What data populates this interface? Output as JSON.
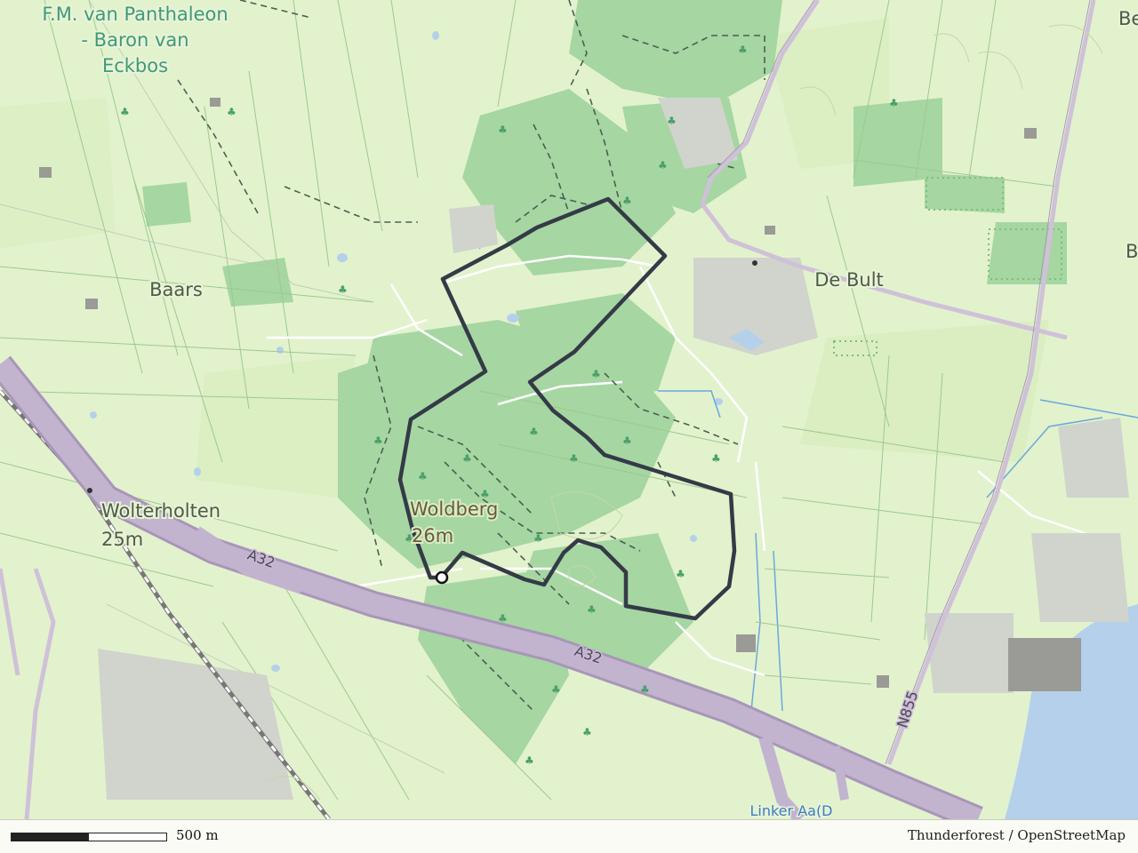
{
  "map": {
    "labels": {
      "park_line1": "F.M. van Panthaleon",
      "park_line2": "- Baron van",
      "park_line3": "Eckbos",
      "baars": "Baars",
      "de_bult": "De Bult",
      "wolterholten": "Wolterholten",
      "wolterholten_ele": "25m",
      "woldberg": "Woldberg",
      "woldberg_ele": "26m",
      "edge_b": "Be",
      "edge_b2": "B"
    },
    "roads": {
      "a32_upper": "A32",
      "a32_lower": "A32",
      "n855": "N855"
    },
    "water": {
      "river": "Linker Aa(D"
    },
    "colors": {
      "background": "#dff0c8",
      "forest": "#a9d9a5",
      "motorway": "#b9a9c8",
      "route": "#353a47",
      "water": "#b5d0ea"
    }
  },
  "footer": {
    "scale_label": "500 m",
    "attribution": "Thunderforest / OpenStreetMap"
  }
}
